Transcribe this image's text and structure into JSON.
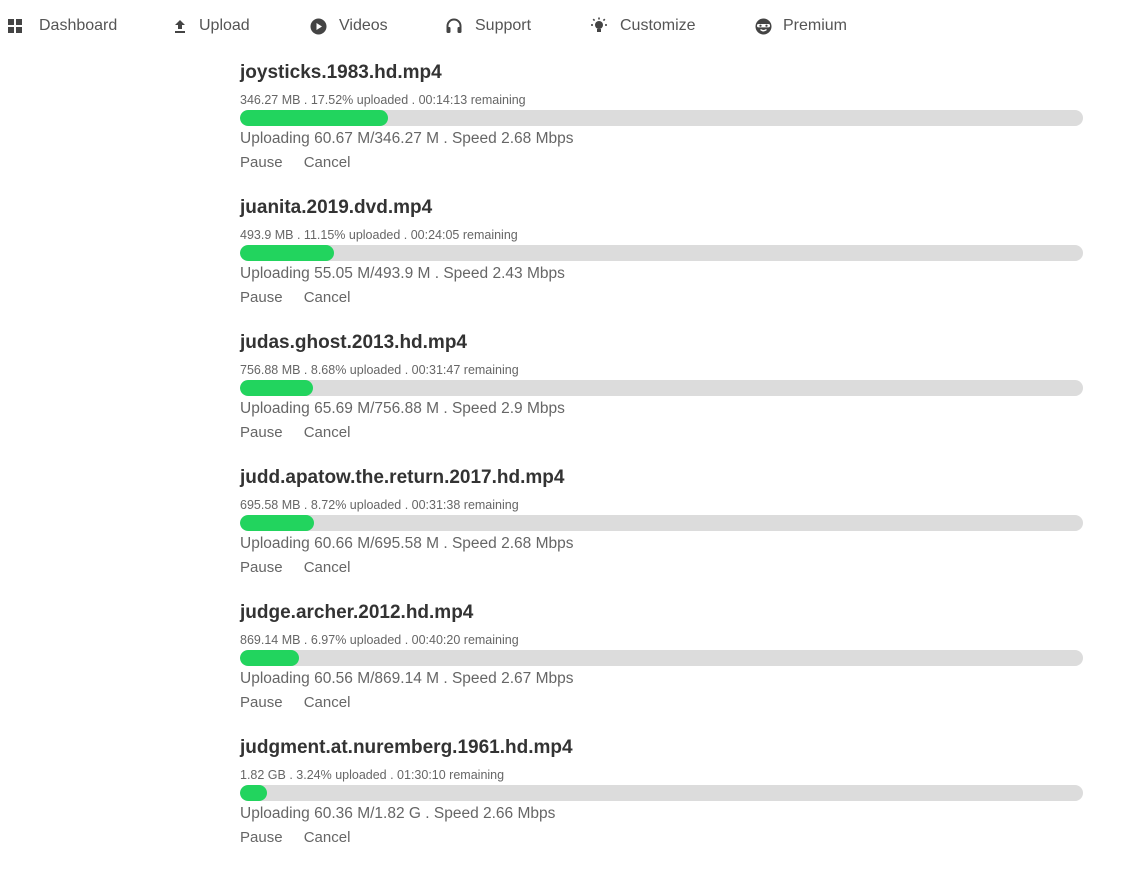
{
  "nav": {
    "items": [
      {
        "label": "Dashboard",
        "icon": "dashboard-grid-icon"
      },
      {
        "label": "Upload",
        "icon": "upload-icon"
      },
      {
        "label": "Videos",
        "icon": "play-circle-icon"
      },
      {
        "label": "Support",
        "icon": "headphones-icon"
      },
      {
        "label": "Customize",
        "icon": "lightbulb-icon"
      },
      {
        "label": "Premium",
        "icon": "premium-mask-icon"
      }
    ]
  },
  "actions": {
    "pause_label": "Pause",
    "cancel_label": "Cancel"
  },
  "colors": {
    "progress_fill": "#22d45e",
    "progress_track": "#dcdcdc"
  },
  "uploads": [
    {
      "name": "joysticks.1983.hd.mp4",
      "meta": "346.27 MB . 17.52% uploaded . 00:14:13 remaining",
      "progress_percent": 17.52,
      "status": "Uploading 60.67 M/346.27 M . Speed 2.68 Mbps"
    },
    {
      "name": "juanita.2019.dvd.mp4",
      "meta": "493.9 MB . 11.15% uploaded . 00:24:05 remaining",
      "progress_percent": 11.15,
      "status": "Uploading 55.05 M/493.9 M . Speed 2.43 Mbps"
    },
    {
      "name": "judas.ghost.2013.hd.mp4",
      "meta": "756.88 MB . 8.68% uploaded . 00:31:47 remaining",
      "progress_percent": 8.68,
      "status": "Uploading 65.69 M/756.88 M . Speed 2.9 Mbps"
    },
    {
      "name": "judd.apatow.the.return.2017.hd.mp4",
      "meta": "695.58 MB . 8.72% uploaded . 00:31:38 remaining",
      "progress_percent": 8.72,
      "status": "Uploading 60.66 M/695.58 M . Speed 2.68 Mbps"
    },
    {
      "name": "judge.archer.2012.hd.mp4",
      "meta": "869.14 MB . 6.97% uploaded . 00:40:20 remaining",
      "progress_percent": 6.97,
      "status": "Uploading 60.56 M/869.14 M . Speed 2.67 Mbps"
    },
    {
      "name": "judgment.at.nuremberg.1961.hd.mp4",
      "meta": "1.82 GB . 3.24% uploaded . 01:30:10 remaining",
      "progress_percent": 3.24,
      "status": "Uploading 60.36 M/1.82 G . Speed 2.66 Mbps"
    }
  ]
}
